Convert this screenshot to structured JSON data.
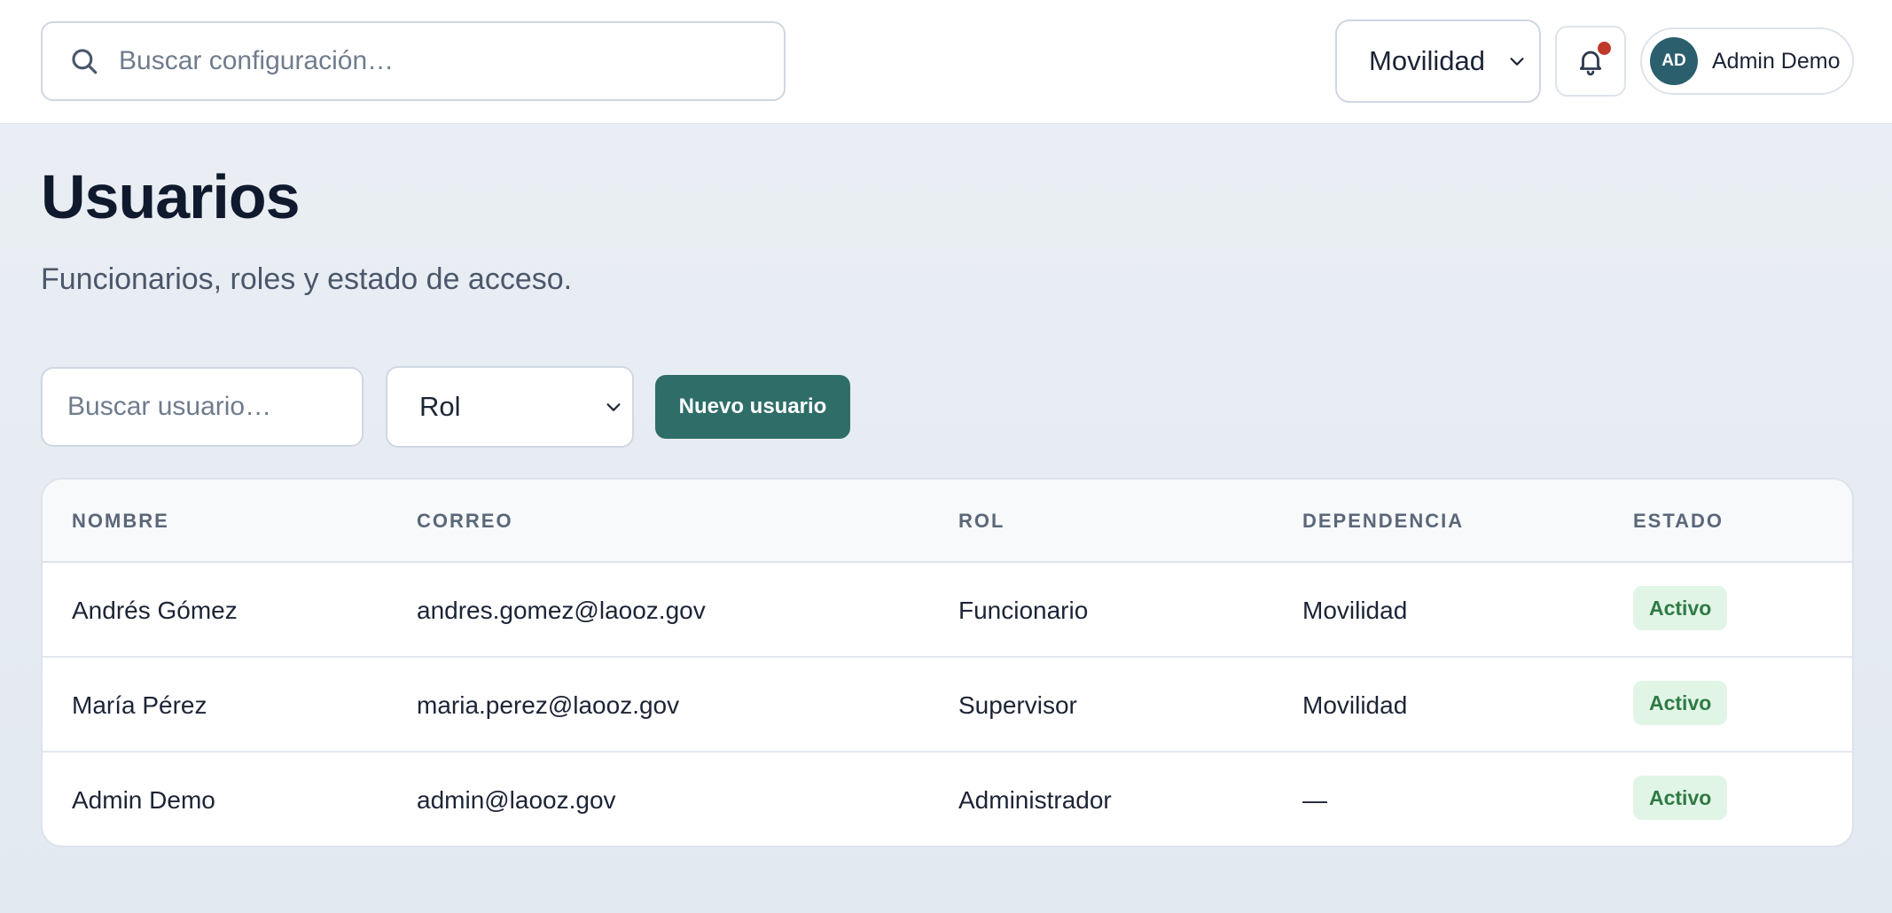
{
  "topbar": {
    "search_placeholder": "Buscar configuración…",
    "department": "Movilidad",
    "user": {
      "initials": "AD",
      "name": "Admin Demo"
    }
  },
  "page": {
    "title": "Usuarios",
    "subtitle": "Funcionarios, roles y estado de acceso."
  },
  "filters": {
    "search_placeholder": "Buscar usuario…",
    "role_label": "Rol",
    "new_user_label": "Nuevo usuario"
  },
  "table": {
    "headers": [
      "NOMBRE",
      "CORREO",
      "ROL",
      "DEPENDENCIA",
      "ESTADO"
    ],
    "rows": [
      {
        "name": "Andrés Gómez",
        "email": "andres.gomez@laooz.gov",
        "role": "Funcionario",
        "dept": "Movilidad",
        "status": "Activo"
      },
      {
        "name": "María Pérez",
        "email": "maria.perez@laooz.gov",
        "role": "Supervisor",
        "dept": "Movilidad",
        "status": "Activo"
      },
      {
        "name": "Admin Demo",
        "email": "admin@laooz.gov",
        "role": "Administrador",
        "dept": "—",
        "status": "Activo"
      }
    ]
  },
  "icons": {
    "search": "search-icon",
    "bell": "bell-icon",
    "chevron": "chevron-down-icon"
  },
  "colors": {
    "accent": "#2f6e68",
    "avatar": "#2b5f6d",
    "notification_dot": "#c0392b",
    "status_active_bg": "#e1f5e6",
    "status_active_text": "#2f7a45"
  }
}
